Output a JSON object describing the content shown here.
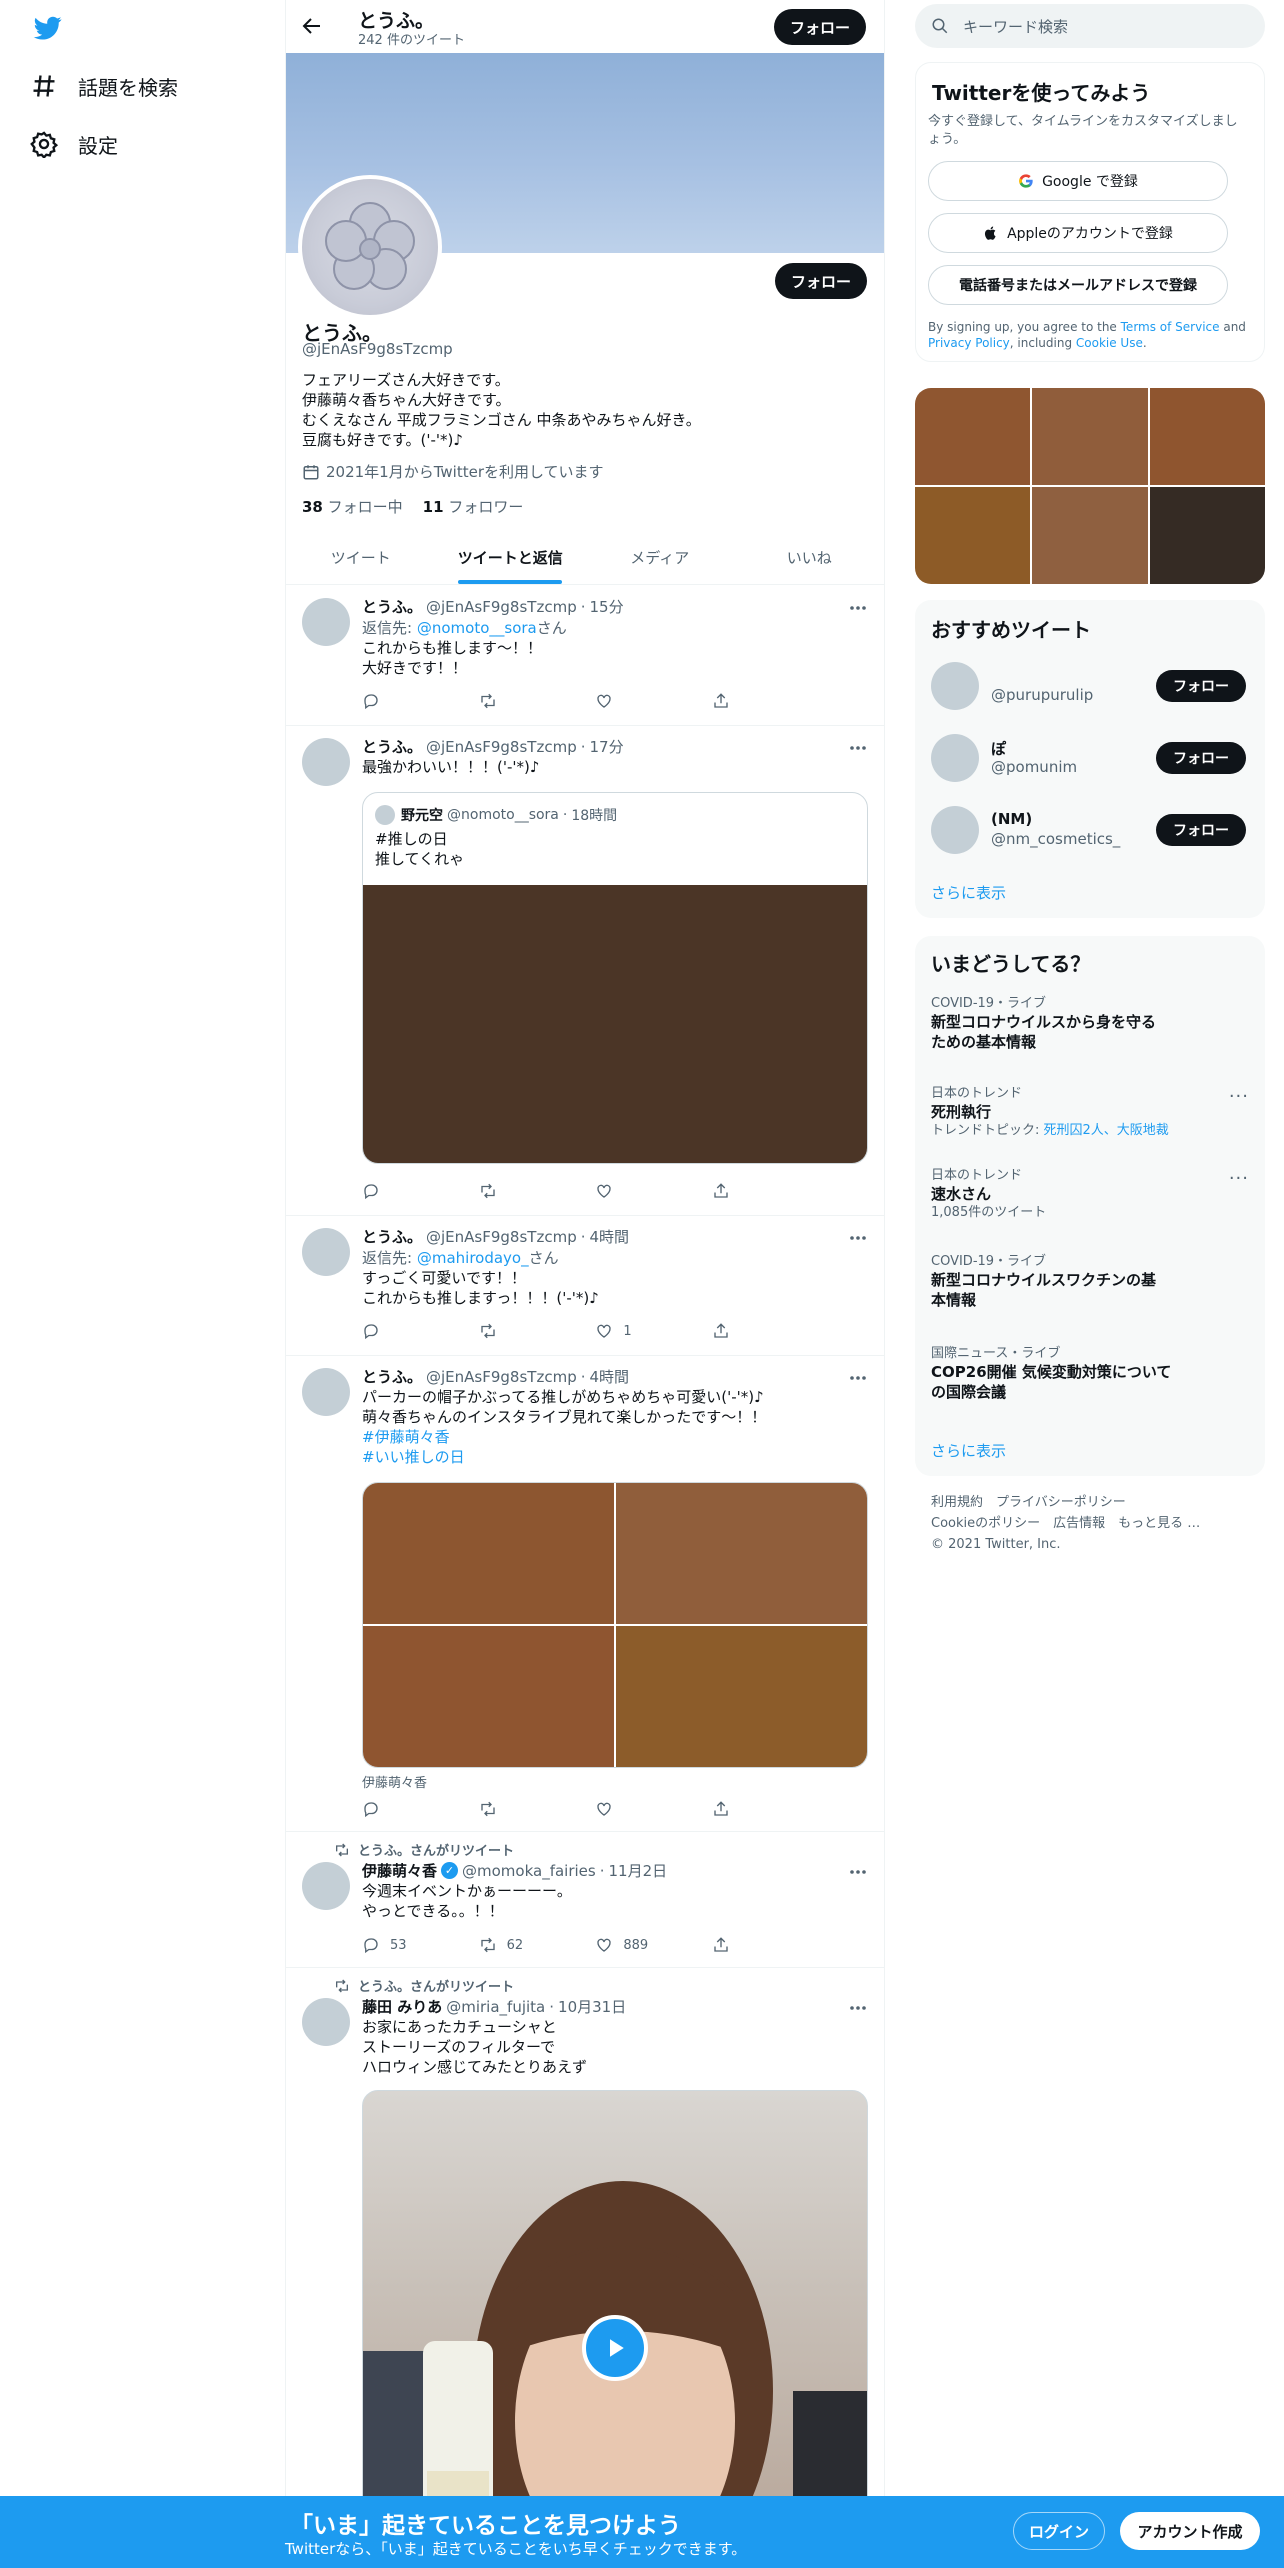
{
  "colors": {
    "accent": "#1d9bf0",
    "dark": "#0f1419",
    "muted": "#536471"
  },
  "nav": {
    "explore": "話題を検索",
    "settings": "設定"
  },
  "profile": {
    "name": "とうふ。",
    "tweet_count": "242 件のツイート",
    "follow": "フォロー",
    "handle": "@jEnAsF9g8sTzcmp",
    "bio": "フェアリーズさん大好きです。\n伊藤萌々香ちゃん大好きです。\nむくえなさん 平成フラミンゴさん 中条あやみちゃん好き。\n豆腐も好きです。('-'*)♪",
    "joined": "2021年1月からTwitterを利用しています",
    "following_count": "38",
    "following_label": "フォロー中",
    "followers_count": "11",
    "followers_label": "フォロワー"
  },
  "tabs": [
    "ツイート",
    "ツイートと返信",
    "メディア",
    "いいね"
  ],
  "tweets": [
    {
      "name": "とうふ。",
      "handle": "@jEnAsF9g8sTzcmp",
      "time": "15分",
      "reply_to_label": "返信先:",
      "reply_to": "@nomoto__sora",
      "reply_suffix": "さん",
      "text": "これからも推します～！！\n大好きです！！"
    },
    {
      "name": "とうふ。",
      "handle": "@jEnAsF9g8sTzcmp",
      "time": "17分",
      "text": "最強かわいい！！！('-'*)♪",
      "quote": {
        "name": "野元空",
        "handle": "@nomoto__sora",
        "time": "18時間",
        "text": "#推しの日\n推してくれゃ"
      }
    },
    {
      "name": "とうふ。",
      "handle": "@jEnAsF9g8sTzcmp",
      "time": "4時間",
      "reply_to_label": "返信先:",
      "reply_to": "@mahirodayo_",
      "reply_suffix": "さん",
      "text": "すっごく可愛いです！！\nこれからも推しますっ！！！('-'*)♪",
      "likes": "1"
    },
    {
      "name": "とうふ。",
      "handle": "@jEnAsF9g8sTzcmp",
      "time": "4時間",
      "text": "パーカーの帽子かぶってる推しがめちゃめちゃ可愛い('-'*)♪\n萌々香ちゃんのインスタライブ見れて楽しかったです～！！",
      "tags": [
        "#伊藤萌々香",
        "#いい推しの日"
      ],
      "caption": "伊藤萌々香"
    },
    {
      "retweet_label": "とうふ。さんがリツイート",
      "name": "伊藤萌々香",
      "handle": "@momoka_fairies",
      "time": "11月2日",
      "text": "今週末イベントかぁーーーー。\nやっとできる。。！！",
      "replies": "53",
      "retweets": "62",
      "likes": "889"
    },
    {
      "retweet_label": "とうふ。さんがリツイート",
      "name": "藤田 みりあ",
      "handle": "@miria_fujita",
      "time": "10月31日",
      "text": "お家にあったカチューシャと\nストーリーズのフィルターで\nハロウィン感じてみたとりあえず"
    }
  ],
  "search": {
    "placeholder": "キーワード検索"
  },
  "signup": {
    "title": "Twitterを使ってみよう",
    "subtitle": "今すぐ登録して、タイムラインをカスタマイズしましょう。",
    "google": "Google で登録",
    "apple": "Appleのアカウントで登録",
    "phone": "電話番号またはメールアドレスで登録",
    "legal_pre": "By signing up, you agree to the ",
    "tos": "Terms of Service",
    "legal_and": " and ",
    "privacy": "Privacy Policy",
    "legal_incl": ", including ",
    "cookie": "Cookie Use",
    "legal_end": "."
  },
  "recommend": {
    "title": "おすすめツイート",
    "follow": "フォロー",
    "more": "さらに表示",
    "users": [
      {
        "name": "",
        "handle": "@purupurulip"
      },
      {
        "name": "ぽ",
        "handle": "@pomunim"
      },
      {
        "name": "(NM)",
        "handle": "@nm_cosmetics_"
      }
    ]
  },
  "trends": {
    "title": "いまどうしてる？",
    "more": "さらに表示",
    "items": [
      {
        "context": "COVID-19・ライブ",
        "title": "新型コロナウイルスから身を守る\nための基本情報"
      },
      {
        "context": "日本のトレンド",
        "title": "死刑執行",
        "meta_label": "トレンドトピック: ",
        "meta_links": "死刑囚2人、大阪地裁",
        "has_more": true
      },
      {
        "context": "日本のトレンド",
        "title": "速水さん",
        "meta": "1,085件のツイート",
        "has_more": true
      },
      {
        "context": "COVID-19・ライブ",
        "title": "新型コロナウイルスワクチンの基\n本情報"
      },
      {
        "context": "国際ニュース・ライブ",
        "title": "COP26開催 気候変動対策について\nの国際会議"
      }
    ]
  },
  "footer": {
    "links": "利用規約　プライバシーポリシー\nCookieのポリシー　広告情報　もっと見る …\n© 2021 Twitter, Inc."
  },
  "bottom": {
    "title": "「いま」起きていることを見つけよう",
    "subtitle": "Twitterなら、「いま」起きていることをいち早くチェックできます。",
    "login": "ログイン",
    "signup": "アカウント作成"
  }
}
